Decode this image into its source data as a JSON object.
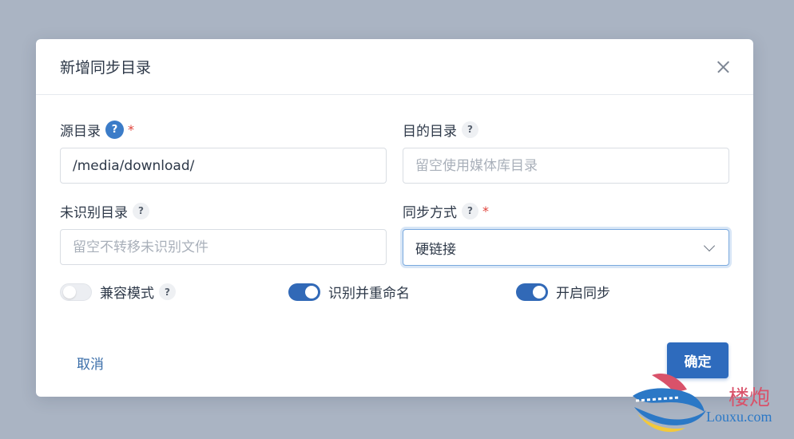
{
  "dialog": {
    "title": "新增同步目录"
  },
  "fields": {
    "source": {
      "label": "源目录",
      "value": "/media/download/",
      "required": true
    },
    "target": {
      "label": "目的目录",
      "placeholder": "留空使用媒体库目录"
    },
    "unrecognized": {
      "label": "未识别目录",
      "placeholder": "留空不转移未识别文件"
    },
    "sync_mode": {
      "label": "同步方式",
      "value": "硬链接",
      "required": true
    }
  },
  "help_glyph": "?",
  "required_mark": "*",
  "switches": {
    "compat": {
      "label": "兼容模式",
      "on": false
    },
    "rename": {
      "label": "识别并重命名",
      "on": true
    },
    "enable": {
      "label": "开启同步",
      "on": true
    }
  },
  "actions": {
    "cancel": "取消",
    "confirm": "确定"
  },
  "watermark": {
    "cn": "楼炮",
    "en": "Louxu.com"
  },
  "colors": {
    "overlay": "#aab4c3",
    "primary": "#2e6bbd",
    "required": "#e0423a"
  }
}
